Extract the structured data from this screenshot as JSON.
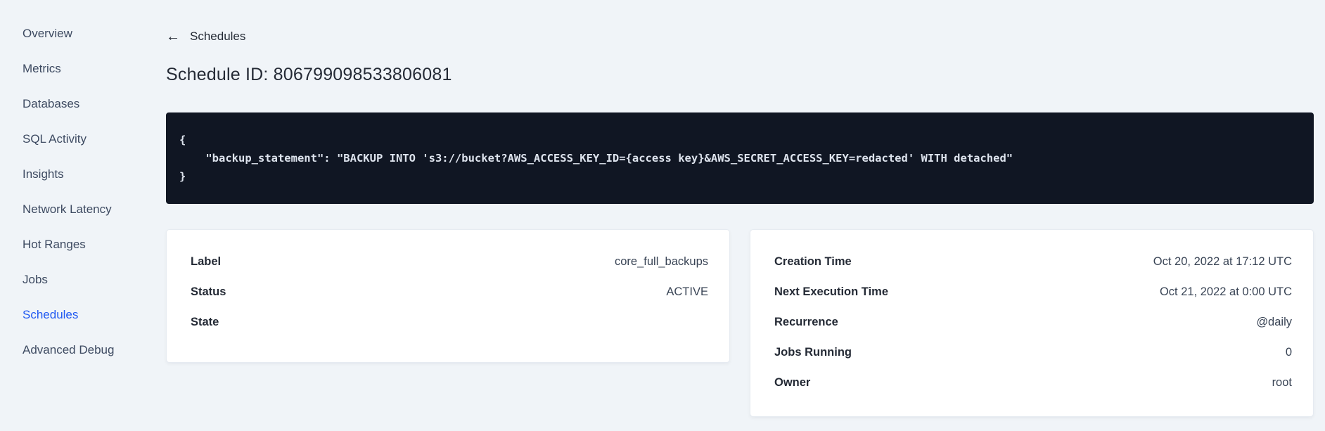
{
  "sidebar": {
    "items": [
      {
        "label": "Overview",
        "active": false
      },
      {
        "label": "Metrics",
        "active": false
      },
      {
        "label": "Databases",
        "active": false
      },
      {
        "label": "SQL Activity",
        "active": false
      },
      {
        "label": "Insights",
        "active": false
      },
      {
        "label": "Network Latency",
        "active": false
      },
      {
        "label": "Hot Ranges",
        "active": false
      },
      {
        "label": "Jobs",
        "active": false
      },
      {
        "label": "Schedules",
        "active": true
      },
      {
        "label": "Advanced Debug",
        "active": false
      }
    ]
  },
  "header": {
    "back_icon_glyph": "←",
    "back_label": "Schedules",
    "title": "Schedule ID: 806799098533806081"
  },
  "code_block": {
    "lines": [
      "{",
      "    \"backup_statement\": \"BACKUP INTO 's3://bucket?AWS_ACCESS_KEY_ID={access key}&AWS_SECRET_ACCESS_KEY=redacted' WITH detached\"",
      "}"
    ]
  },
  "details_card": {
    "rows": [
      {
        "label": "Label",
        "value": "core_full_backups"
      },
      {
        "label": "Status",
        "value": "ACTIVE"
      },
      {
        "label": "State",
        "value": ""
      }
    ]
  },
  "schedule_card": {
    "rows": [
      {
        "label": "Creation Time",
        "value": "Oct 20, 2022 at 17:12 UTC"
      },
      {
        "label": "Next Execution Time",
        "value": "Oct 21, 2022 at 0:00 UTC"
      },
      {
        "label": "Recurrence",
        "value": "@daily"
      },
      {
        "label": "Jobs Running",
        "value": "0"
      },
      {
        "label": "Owner",
        "value": "root"
      }
    ]
  },
  "colors": {
    "accent_blue": "#2059f2",
    "page_background": "#f0f4f8",
    "code_background": "#101623",
    "code_text": "#dde3ed",
    "text_primary": "#242a35",
    "text_secondary": "#394455",
    "card_background": "#ffffff",
    "card_border": "#e6ebf1"
  }
}
